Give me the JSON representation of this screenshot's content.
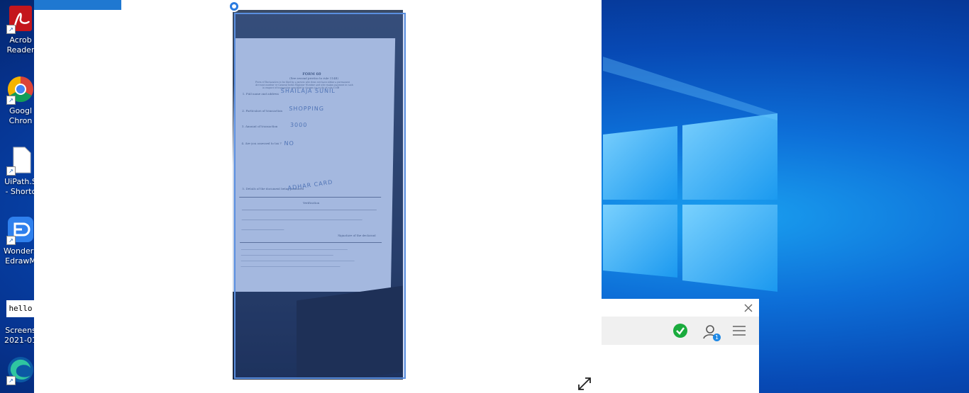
{
  "desktop": {
    "icons": [
      {
        "name": "acrobat-reader",
        "label": "Acrob\nReader"
      },
      {
        "name": "google-chrome",
        "label": "Googl\nChron"
      },
      {
        "name": "uipath-shortcut",
        "label": "UiPath.S\n- Shortc"
      },
      {
        "name": "wondershare-edrawmax",
        "label": "Wonders\nEdrawM"
      },
      {
        "name": "screenshot-file",
        "label": "Screens\n2021-01",
        "icon_text": "hello"
      },
      {
        "name": "microsoft-edge",
        "label": ""
      }
    ]
  },
  "viewer": {
    "document": {
      "heading": "FORM 60",
      "subheading": "(See second proviso to rule 114B)",
      "lines": [
        "Form of Declaration to be filed by a person who does not have either a permanent",
        "Account number or General Index Register Number and who makes payment in cash",
        "in respect of transaction specified in clauses (a) to (h) of rule 114B"
      ],
      "fields": [
        {
          "label": "1. Full name and address",
          "value": "SHAILAJA SUNIL"
        },
        {
          "label": "2. Particulars of transaction",
          "value": "SHOPPING"
        },
        {
          "label": "3. Amount of transaction",
          "value": "3000"
        },
        {
          "label": "4. Are you assessed to tax ?",
          "value": "NO"
        },
        {
          "label": "5. Details of the document being produced",
          "value": "ADHAR CARD"
        }
      ],
      "verification_title": "Verification",
      "footer_note": "Signature of the declarant"
    }
  },
  "panel": {
    "user_badge": "1"
  },
  "colors": {
    "accent": "#2a7be0",
    "ok_green": "#1aab3d",
    "selection_border": "#5a8fe0"
  }
}
